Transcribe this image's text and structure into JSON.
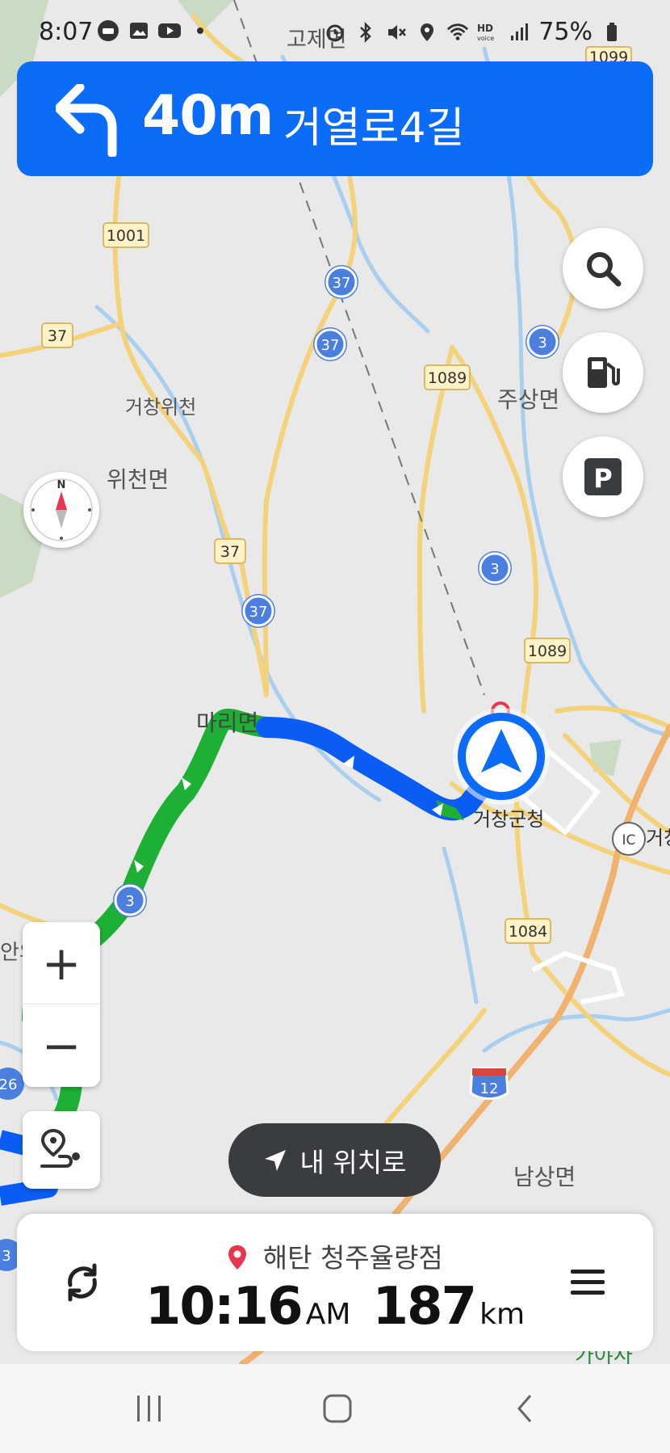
{
  "status_bar": {
    "time": "8:07",
    "battery_percent": "75%",
    "left_icons": [
      "car-icon",
      "image-icon",
      "youtube-icon",
      "dot-icon"
    ],
    "right_icons": [
      "alarm-icon",
      "bluetooth-icon",
      "mute-icon",
      "location-icon",
      "wifi-icon",
      "hd-voice-icon",
      "signal-icon",
      "battery-icon"
    ]
  },
  "turn_banner": {
    "distance": "40m",
    "street": "거열로4길",
    "icon": "turn-left-arrow-icon",
    "color": "#0A6CF7"
  },
  "map": {
    "place_labels": [
      "고제면",
      "거창위천",
      "위천면",
      "주상면",
      "마리면",
      "거창군청",
      "남상면",
      "거창",
      "가야사"
    ],
    "partial_label": "안의",
    "road_shields": [
      "1001",
      "37",
      "1089",
      "1099",
      "1084",
      "3",
      "26",
      "12",
      "IC"
    ],
    "route_colors": {
      "traffic_free": "#0A5CF5",
      "traffic_light": "#1DB034"
    }
  },
  "side_buttons": {
    "search": "search-icon",
    "fuel": "fuel-icon",
    "parking": "P"
  },
  "compass": {
    "north_label": "N"
  },
  "zoom": {
    "in_label": "+",
    "out_label": "−"
  },
  "my_location": {
    "label": "내 위치로"
  },
  "trip": {
    "destination": "해탄 청주율량점",
    "eta_time": "10:16",
    "eta_ampm": "AM",
    "distance_value": "187",
    "distance_unit": "km"
  },
  "colors": {
    "accent": "#0A6CF7",
    "pill_bg": "#3A3D40",
    "pin": "#E8364E"
  }
}
